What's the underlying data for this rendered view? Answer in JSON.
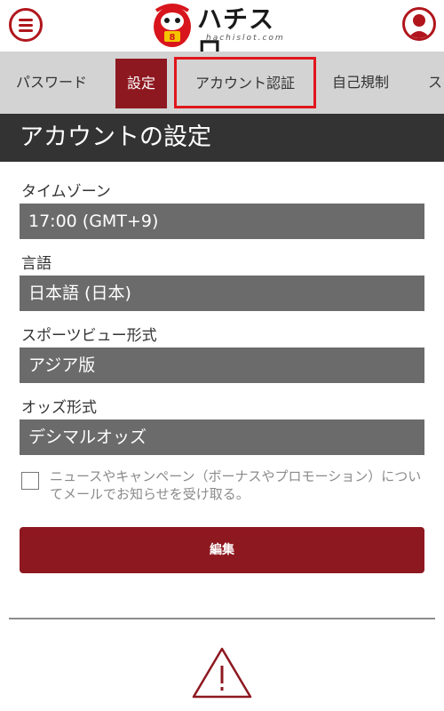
{
  "header": {
    "logo_text": "ハチスロ",
    "logo_sub": "hachislot.com"
  },
  "tabs": [
    {
      "label": "パスワード"
    },
    {
      "label": "設定"
    },
    {
      "label": "アカウント認証"
    },
    {
      "label": "自己規制"
    },
    {
      "label": "ス"
    }
  ],
  "section": {
    "title": "アカウントの設定"
  },
  "form": {
    "timezone": {
      "label": "タイムゾーン",
      "value": "17:00 (GMT+9)"
    },
    "language": {
      "label": "言語",
      "value": "日本語 (日本)"
    },
    "sports_view": {
      "label": "スポーツビュー形式",
      "value": "アジア版"
    },
    "odds_format": {
      "label": "オッズ形式",
      "value": "デシマルオッズ"
    },
    "newsletter": {
      "label": "ニュースやキャンペーン（ボーナスやプロモーション）についてメールでお知らせを受け取る。",
      "checked": false
    },
    "edit_button": "編集"
  },
  "colors": {
    "brand": "#8e1820",
    "highlight": "#e0161c",
    "section_bg": "#333333",
    "field_bg": "#6b6b6b"
  },
  "icons": {
    "menu": "hamburger-menu-icon",
    "profile": "user-icon",
    "alert": "warning-icon"
  }
}
